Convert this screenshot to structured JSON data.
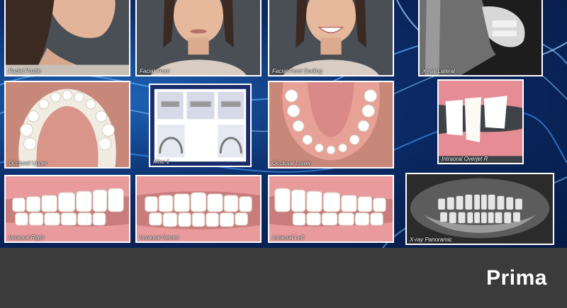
{
  "footer": {
    "brand": "Prima"
  },
  "images": [
    {
      "id": "facial-profile",
      "caption": "Facial Profile"
    },
    {
      "id": "facial-front",
      "caption": "Facial Front"
    },
    {
      "id": "facial-front-smiling",
      "caption": "Facial Front Smiling"
    },
    {
      "id": "xray-lateral",
      "caption": "X-ray Lateral"
    },
    {
      "id": "occlusal-upper",
      "caption": "Occlusal Upper"
    },
    {
      "id": "misc",
      "caption": "Misc 1"
    },
    {
      "id": "occlusal-lower",
      "caption": "Occlusal Lower"
    },
    {
      "id": "intraoral-overjet",
      "caption": "Intraoral Overjet R"
    },
    {
      "id": "intraoral-right",
      "caption": "Intraoral Right"
    },
    {
      "id": "intraoral-center",
      "caption": "Intraoral Center"
    },
    {
      "id": "intraoral-left",
      "caption": "Intraoral Left"
    },
    {
      "id": "xray-panoramic",
      "caption": "X-ray Panoramic"
    }
  ],
  "colors": {
    "background": "#0b2a66",
    "footer": "#3b3b3b",
    "brand_text": "#ffffff"
  }
}
